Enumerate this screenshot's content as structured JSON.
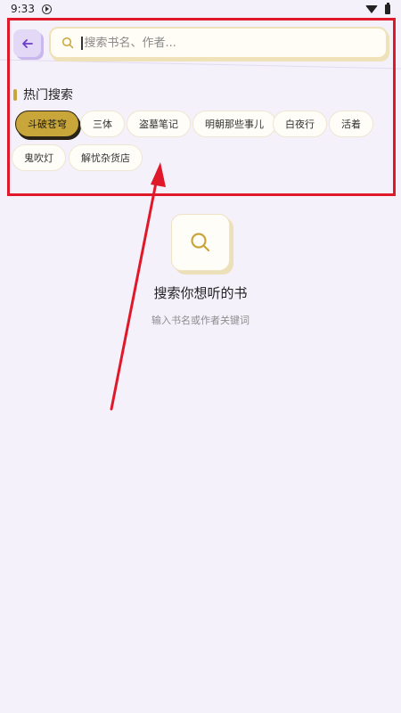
{
  "status_bar": {
    "time": "9:33"
  },
  "search": {
    "placeholder": "搜索书名、作者..."
  },
  "hot_search": {
    "title": "热门搜索",
    "tags": [
      "斗破苍穹",
      "三体",
      "盗墓笔记",
      "明朝那些事儿",
      "白夜行",
      "活着",
      "鬼吹灯",
      "解忧杂货店"
    ],
    "selected_tag": "斗破苍穹"
  },
  "empty_state": {
    "title": "搜索你想听的书",
    "subtitle": "输入书名或作者关键词"
  },
  "colors": {
    "accent": "#c9a63a",
    "background": "#f4f1fb",
    "annotation": "#e0192a"
  }
}
